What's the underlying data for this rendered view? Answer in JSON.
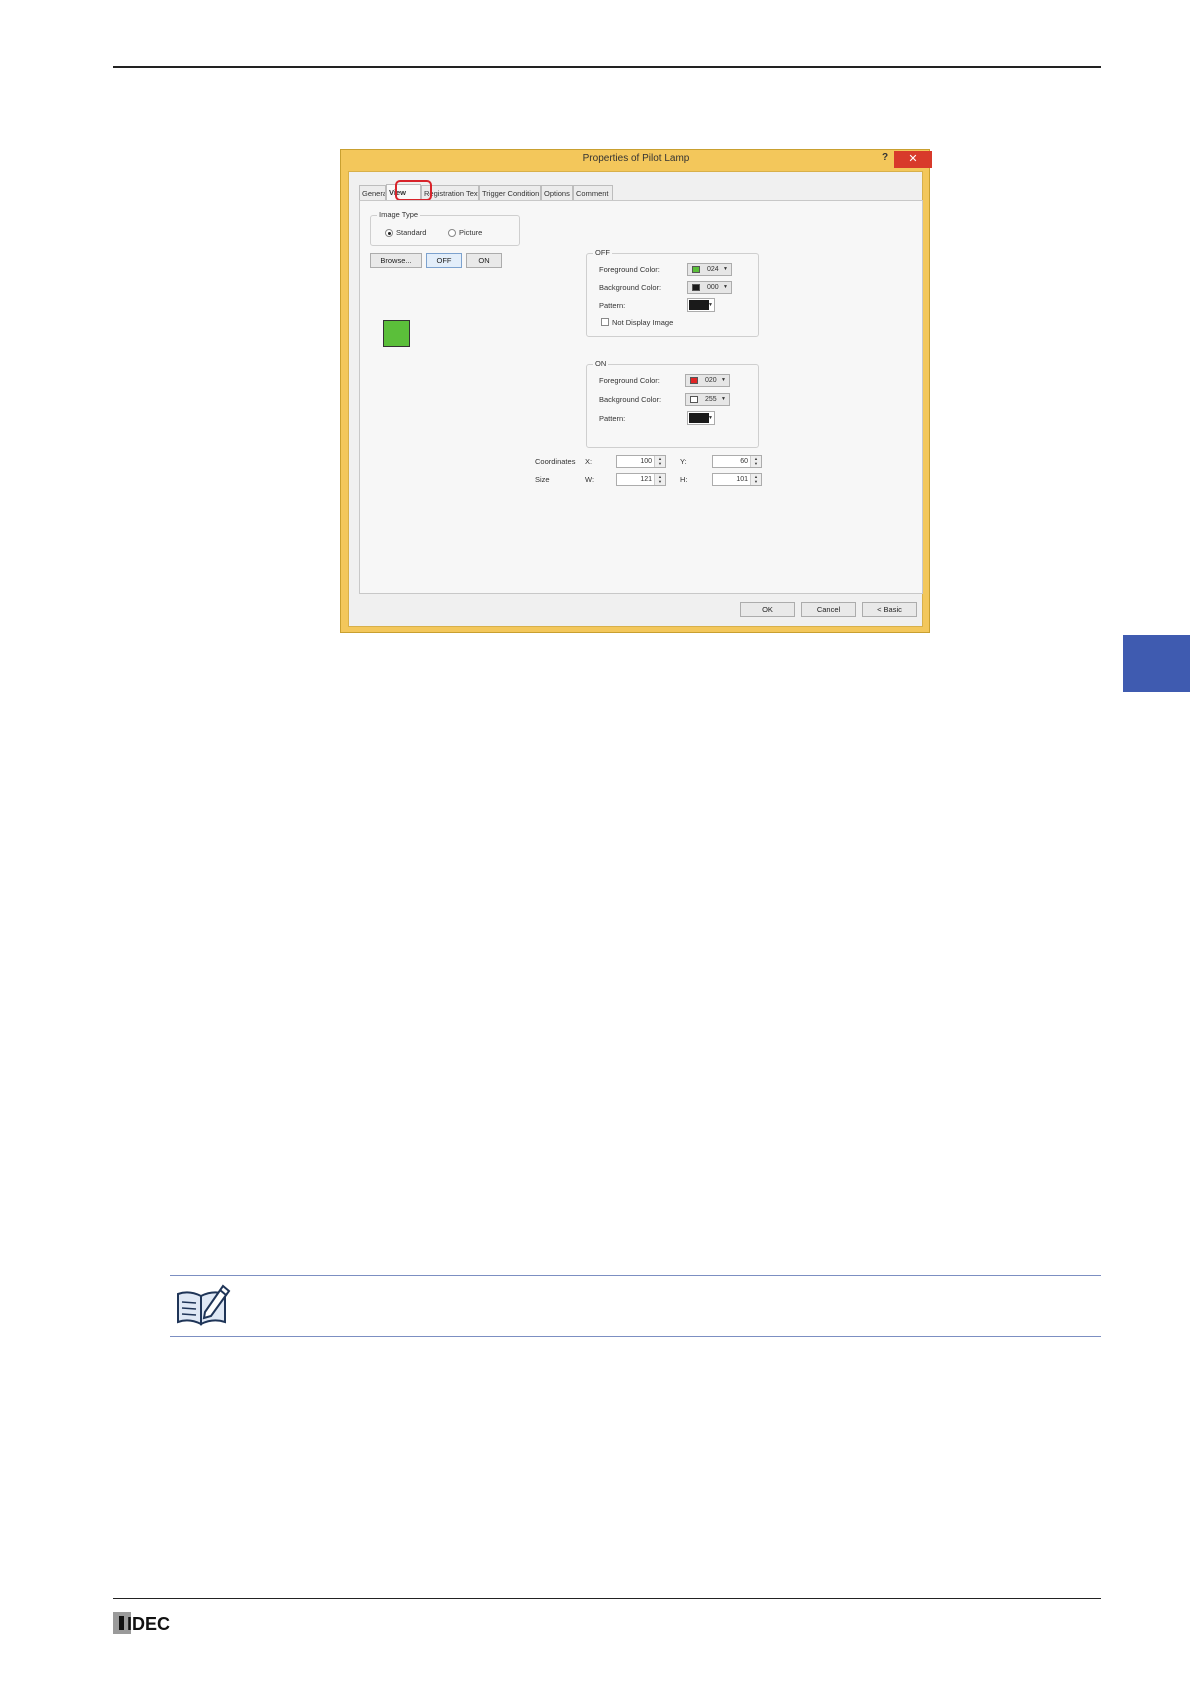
{
  "dialog": {
    "title": "Properties of Pilot Lamp",
    "help_glyph": "?",
    "close_glyph": "✕",
    "tabs": [
      "General",
      "View",
      "Registration Text",
      "Trigger Condition",
      "Options",
      "Comment"
    ],
    "image_type": {
      "legend": "Image Type",
      "standard_label": "Standard",
      "picture_label": "Picture",
      "selected": "Standard"
    },
    "buttons": {
      "browse": "Browse...",
      "off": "OFF",
      "on": "ON"
    },
    "off_group": {
      "legend": "OFF",
      "foreground_label": "Foreground Color:",
      "foreground_value": "024",
      "foreground_color": "#5bbf3a",
      "background_label": "Background Color:",
      "background_value": "000",
      "background_color": "#1a1a1a",
      "pattern_label": "Pattern:",
      "not_display_label": "Not Display Image"
    },
    "on_group": {
      "legend": "ON",
      "foreground_label": "Foreground Color:",
      "foreground_value": "020",
      "foreground_color": "#e02424",
      "background_label": "Background Color:",
      "background_value": "255",
      "background_color": "#ffffff",
      "pattern_label": "Pattern:"
    },
    "coordinates": {
      "label": "Coordinates",
      "x_label": "X:",
      "x_value": "100",
      "y_label": "Y:",
      "y_value": "60"
    },
    "size": {
      "label": "Size",
      "w_label": "W:",
      "w_value": "121",
      "h_label": "H:",
      "h_value": "101"
    },
    "footer": {
      "ok": "OK",
      "cancel": "Cancel",
      "basic": "< Basic"
    }
  },
  "brand": {
    "logo_text": "IDEC"
  }
}
